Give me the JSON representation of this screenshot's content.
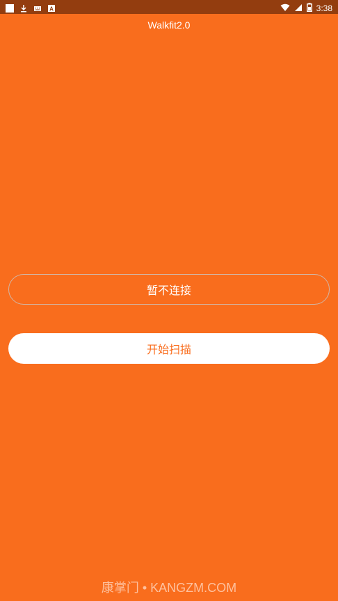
{
  "status_bar": {
    "time": "3:38",
    "left_icons": [
      "square-icon",
      "download-icon",
      "keyboard-icon",
      "font-icon"
    ],
    "right_icons": [
      "wifi-icon",
      "signal-icon",
      "battery-icon"
    ]
  },
  "header": {
    "title": "Walkfit2.0"
  },
  "actions": {
    "skip_connect_label": "暂不连接",
    "start_scan_label": "开始扫描"
  },
  "watermark": {
    "text": "康掌门 • KANGZM.COM"
  },
  "colors": {
    "background": "#f96d1d",
    "status_bar": "#933d0f",
    "button_fill": "#ffffff",
    "button_text_accent": "#f96d1d"
  }
}
